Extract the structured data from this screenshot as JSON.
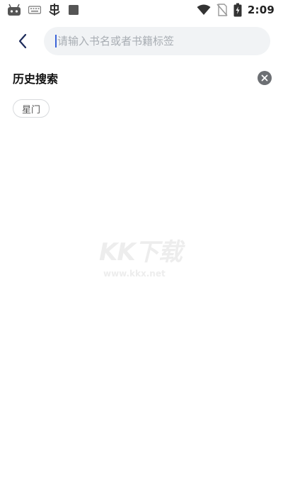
{
  "status_bar": {
    "time": "2:09",
    "left_icons": [
      "android-icon",
      "keyboard-icon",
      "bug-icon",
      "square-icon"
    ],
    "right_icons": [
      "wifi-icon",
      "no-sim-icon",
      "battery-charging-icon"
    ]
  },
  "search": {
    "placeholder": "请输入书名或者书籍标签",
    "value": ""
  },
  "history": {
    "title": "历史搜索",
    "tags": [
      "星门"
    ]
  },
  "watermark": {
    "logo": "KK下载",
    "url": "www.kkx.net"
  },
  "colors": {
    "search_bg": "#f1f3f5",
    "cursor": "#3c64d8",
    "back_arrow": "#1c2a5a",
    "clear_btn": "#6c6f73"
  }
}
